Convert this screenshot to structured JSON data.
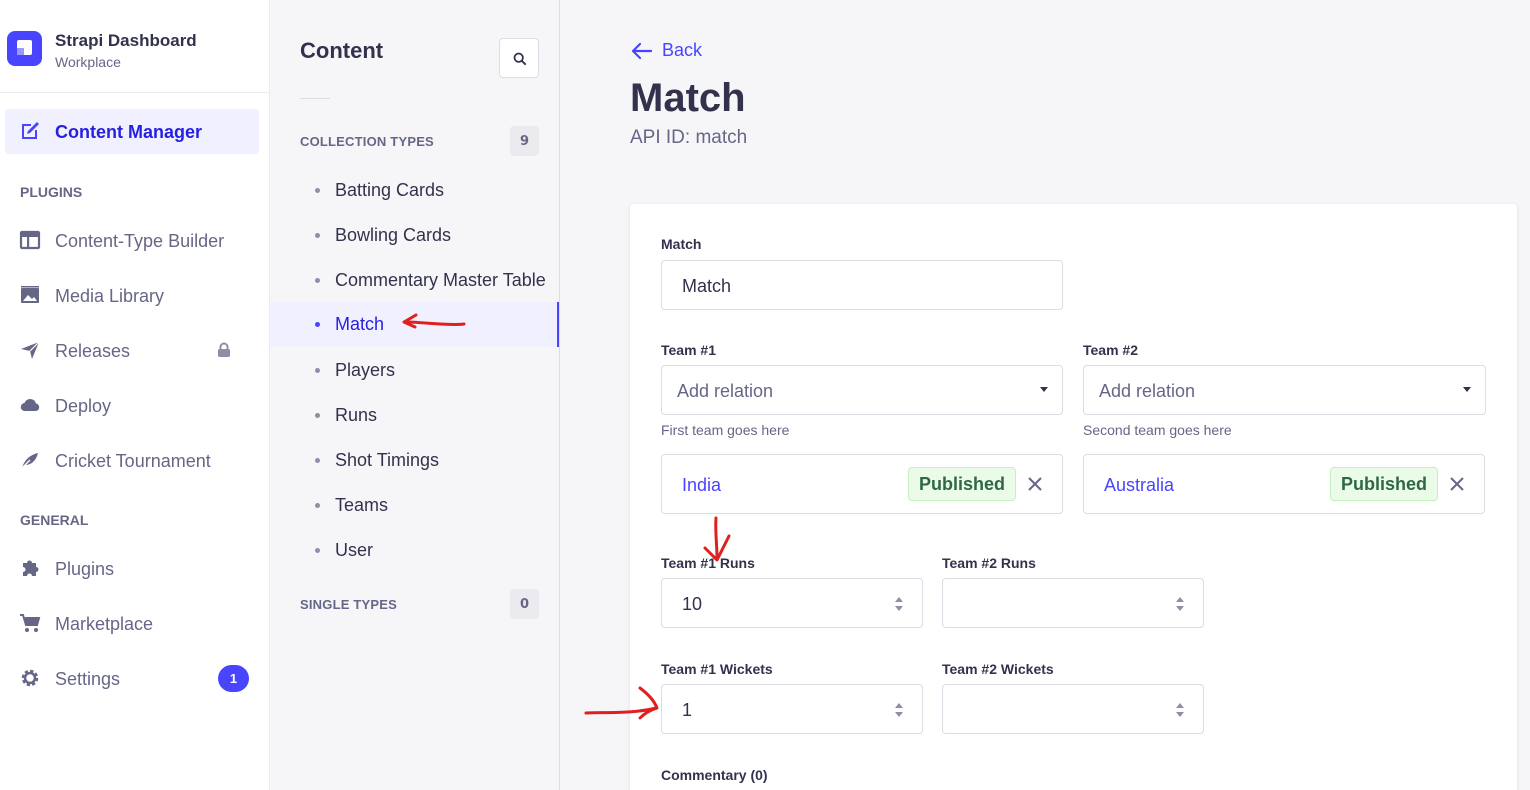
{
  "brand": {
    "title": "Strapi Dashboard",
    "subtitle": "Workplace"
  },
  "leftnav": {
    "active": {
      "label": "Content Manager",
      "icon": "content-manager-icon"
    },
    "plugins_heading": "PLUGINS",
    "plugins": [
      {
        "label": "Content-Type Builder",
        "icon": "layout-icon"
      },
      {
        "label": "Media Library",
        "icon": "image-icon"
      },
      {
        "label": "Releases",
        "icon": "paper-plane-icon",
        "locked": true
      },
      {
        "label": "Deploy",
        "icon": "cloud-icon"
      },
      {
        "label": "Cricket Tournament",
        "icon": "feather-icon"
      }
    ],
    "general_heading": "GENERAL",
    "general": [
      {
        "label": "Plugins",
        "icon": "puzzle-icon"
      },
      {
        "label": "Marketplace",
        "icon": "cart-icon"
      },
      {
        "label": "Settings",
        "icon": "gear-icon",
        "badge": "1"
      }
    ]
  },
  "subnav": {
    "title": "Content",
    "collection_heading": "COLLECTION TYPES",
    "collection_count": "9",
    "collection_items": [
      "Batting Cards",
      "Bowling Cards",
      "Commentary Master Table",
      "Match",
      "Players",
      "Runs",
      "Shot Timings",
      "Teams",
      "User"
    ],
    "active_item": "Match",
    "single_heading": "SINGLE TYPES",
    "single_count": "0"
  },
  "main": {
    "back_label": "Back",
    "title": "Match",
    "api_id": "API ID: match",
    "form": {
      "match_label": "Match",
      "match_value": "Match",
      "team1_label": "Team #1",
      "team1_placeholder": "Add relation",
      "team1_hint": "First team goes here",
      "team1_relation": {
        "name": "India",
        "status": "Published"
      },
      "team2_label": "Team #2",
      "team2_placeholder": "Add relation",
      "team2_hint": "Second team goes here",
      "team2_relation": {
        "name": "Australia",
        "status": "Published"
      },
      "team1_runs_label": "Team #1 Runs",
      "team1_runs_value": "10",
      "team2_runs_label": "Team #2 Runs",
      "team2_runs_value": "",
      "team1_wickets_label": "Team #1 Wickets",
      "team1_wickets_value": "1",
      "team2_wickets_label": "Team #2 Wickets",
      "team2_wickets_value": "",
      "commentary_label": "Commentary (0)"
    }
  },
  "colors": {
    "accent": "#4945ff",
    "annotation": "#e0201e",
    "published_bg": "#eafbe7",
    "published_text": "#2f6846"
  }
}
